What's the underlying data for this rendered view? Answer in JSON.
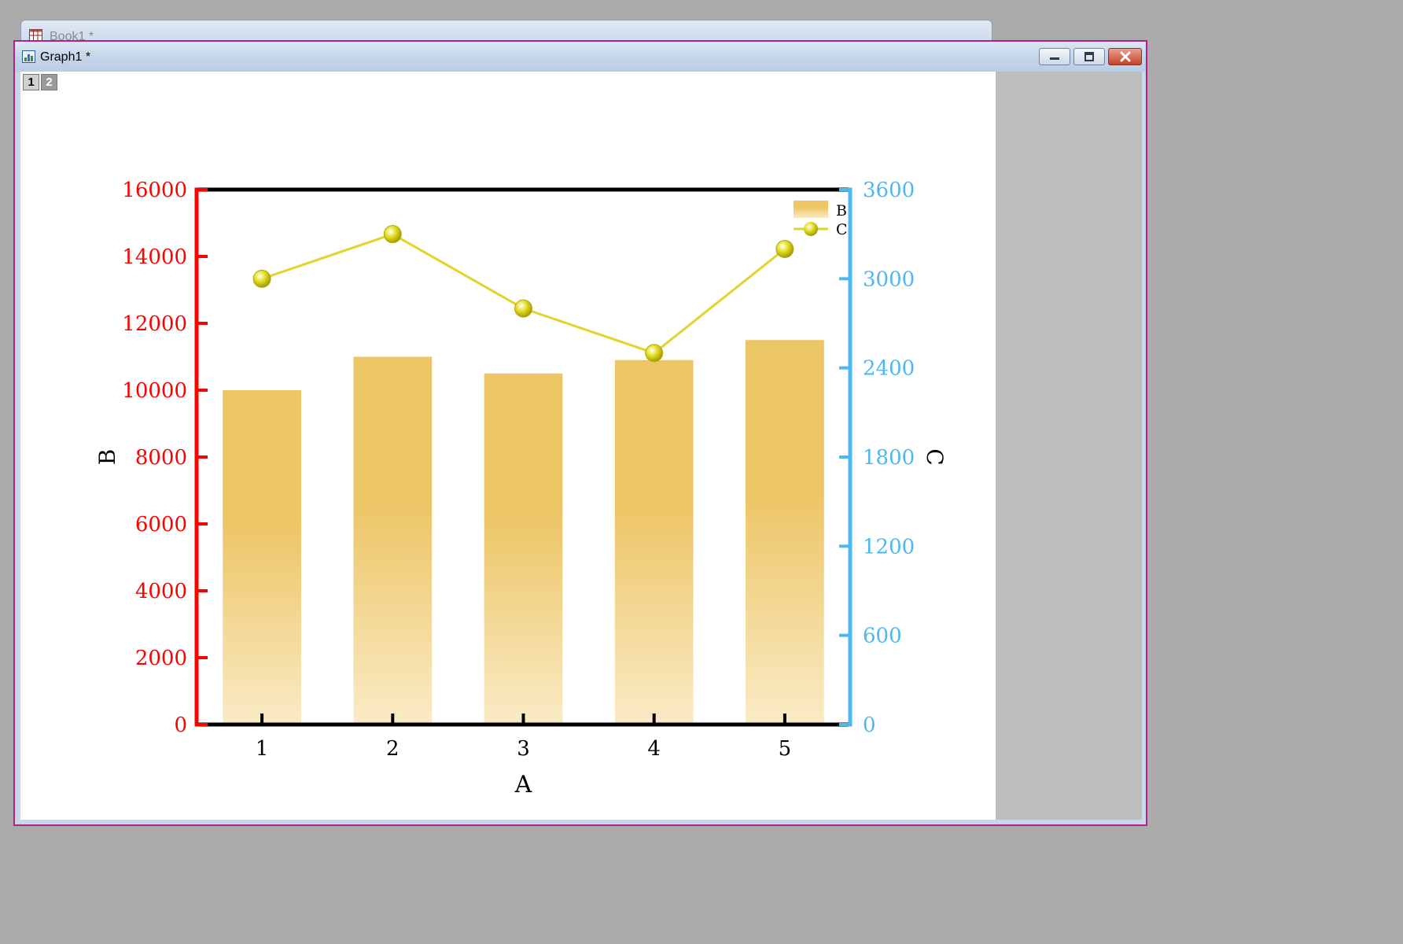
{
  "book_window": {
    "title": "Book1 *"
  },
  "graph_window": {
    "title": "Graph1 *"
  },
  "layer_tabs": [
    "1",
    "2"
  ],
  "colors": {
    "bar_top": "#ecc565",
    "bar_bottom": "#faebc6",
    "line": "#e2d42f",
    "marker": "#e6e22a",
    "left_axis": "#ff0000",
    "right_axis": "#4db8ef",
    "frame": "#000000"
  },
  "chart_data": {
    "type": "bar",
    "categories": [
      "1",
      "2",
      "3",
      "4",
      "5"
    ],
    "series": [
      {
        "name": "B",
        "type": "bar",
        "axis": "left",
        "values": [
          10000,
          11000,
          10500,
          10900,
          11500
        ]
      },
      {
        "name": "C",
        "type": "line",
        "axis": "right",
        "values": [
          3000,
          3300,
          2800,
          2500,
          3200
        ]
      }
    ],
    "xlabel": "A",
    "ylabel": "B",
    "y2label": "C",
    "ylim": [
      0,
      16000
    ],
    "y2lim": [
      0,
      3600
    ],
    "yticks": [
      0,
      2000,
      4000,
      6000,
      8000,
      10000,
      12000,
      14000,
      16000
    ],
    "y2ticks": [
      0,
      600,
      1200,
      1800,
      2400,
      3000,
      3600
    ],
    "legend": "top-right",
    "grid": false
  }
}
